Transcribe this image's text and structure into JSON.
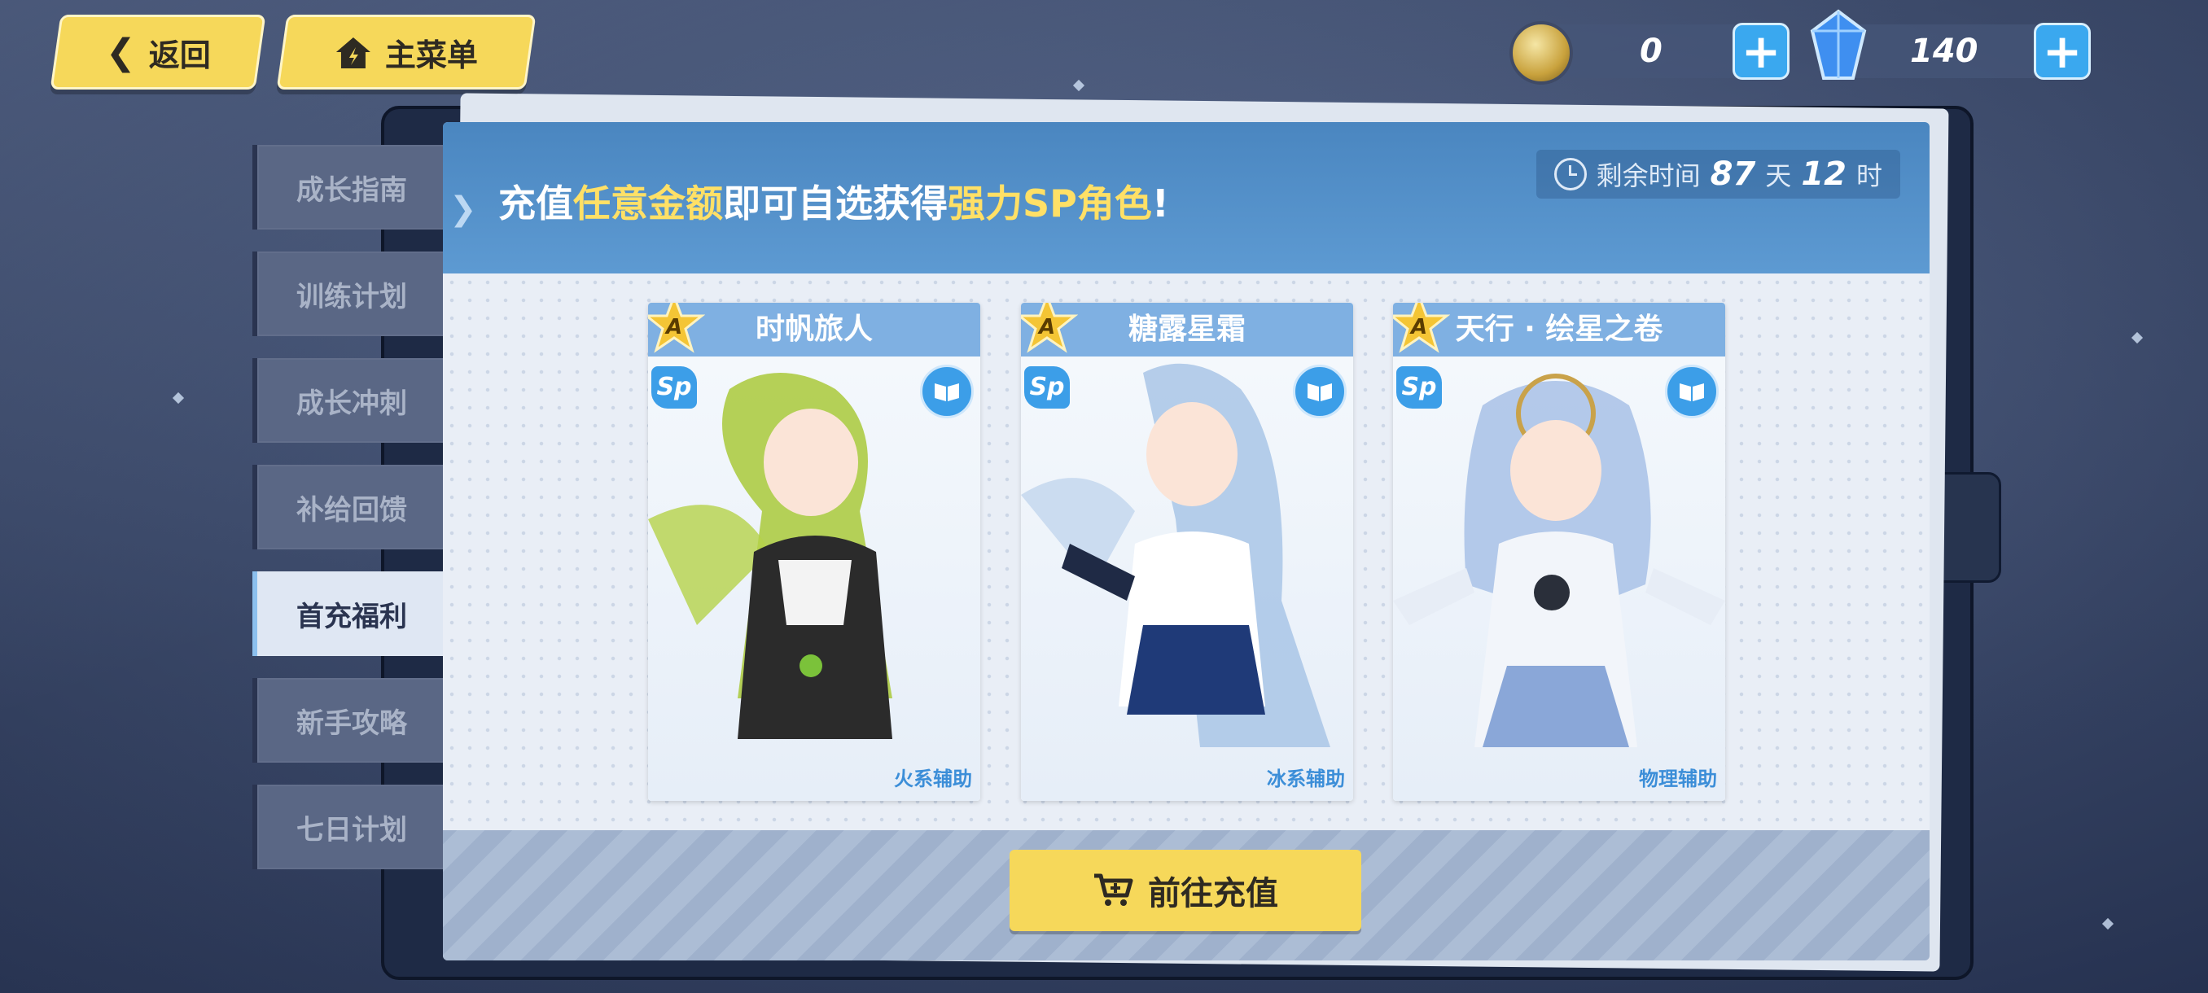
{
  "nav": {
    "back_label": "返回",
    "menu_label": "主菜单"
  },
  "currency": {
    "coin_value": "0",
    "crystal_value": "140"
  },
  "tabs": [
    {
      "label": "成长指南",
      "active": false
    },
    {
      "label": "训练计划",
      "active": false
    },
    {
      "label": "成长冲刺",
      "active": false
    },
    {
      "label": "补给回馈",
      "active": false
    },
    {
      "label": "首充福利",
      "active": true
    },
    {
      "label": "新手攻略",
      "active": false
    },
    {
      "label": "七日计划",
      "active": false
    }
  ],
  "header": {
    "headline_pre": "充值",
    "headline_hl1": "任意金额",
    "headline_mid": "即可自选获得",
    "headline_hl2": "强力SP角色",
    "headline_end": "!",
    "timer_label": "剩余时间",
    "timer_days": "87",
    "timer_days_unit": "天",
    "timer_hours": "12",
    "timer_hours_unit": "时"
  },
  "cards": [
    {
      "rank": "A",
      "name": "时帆旅人",
      "badge": "Sp",
      "role": "火系辅助"
    },
    {
      "rank": "A",
      "name": "糖露星霜",
      "badge": "Sp",
      "role": "冰系辅助"
    },
    {
      "rank": "A",
      "name": "天行 · 绘星之卷",
      "badge": "Sp",
      "role": "物理辅助"
    }
  ],
  "recharge_label": "前往充值",
  "colors": {
    "accent_yellow": "#f6d85a",
    "header_blue": "#5d9ad2",
    "highlight": "#ffe066"
  }
}
